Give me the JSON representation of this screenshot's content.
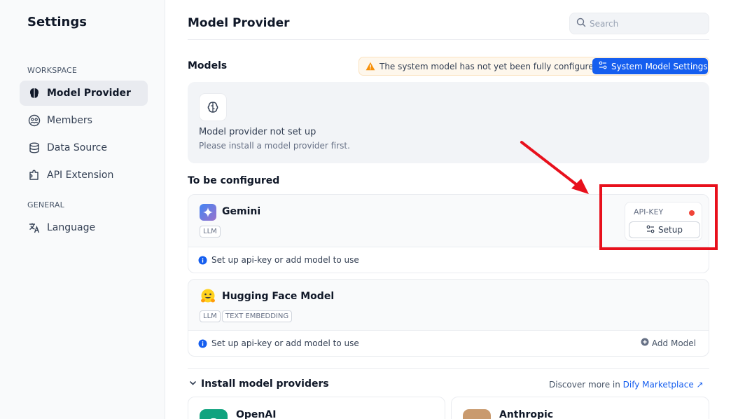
{
  "sidebar": {
    "title": "Settings",
    "workspace_label": "WORKSPACE",
    "general_label": "GENERAL",
    "items": [
      {
        "label": "Model Provider",
        "icon": "brain-icon"
      },
      {
        "label": "Members",
        "icon": "members-icon"
      },
      {
        "label": "Data Source",
        "icon": "database-icon"
      },
      {
        "label": "API Extension",
        "icon": "puzzle-icon"
      },
      {
        "label": "Language",
        "icon": "translate-icon"
      }
    ]
  },
  "header": {
    "title": "Model Provider",
    "search_placeholder": "Search"
  },
  "models": {
    "label": "Models",
    "warning": "The system model has not yet been fully configured",
    "system_button": "System Model Settings",
    "empty_title": "Model provider not set up",
    "empty_subtitle": "Please install a model provider first."
  },
  "to_be_configured": {
    "label": "To be configured",
    "providers": [
      {
        "name": "Gemini",
        "tags": [
          "LLM"
        ],
        "footer": "Set up api-key or add model to use",
        "api_key_label": "API-KEY",
        "setup_label": "Setup"
      },
      {
        "name": "Hugging Face Model",
        "tags": [
          "LLM",
          "TEXT EMBEDDING"
        ],
        "footer": "Set up api-key or add model to use",
        "add_model_label": "Add Model"
      }
    ]
  },
  "install": {
    "label": "Install model providers",
    "discover_text": "Discover more in",
    "marketplace_link": "Dify Marketplace",
    "providers": [
      {
        "name": "OpenAI"
      },
      {
        "name": "Anthropic"
      }
    ]
  },
  "colors": {
    "accent": "#155eef",
    "warning": "#f79009",
    "status_dot": "#f04438",
    "annotation": "#e8101c"
  }
}
